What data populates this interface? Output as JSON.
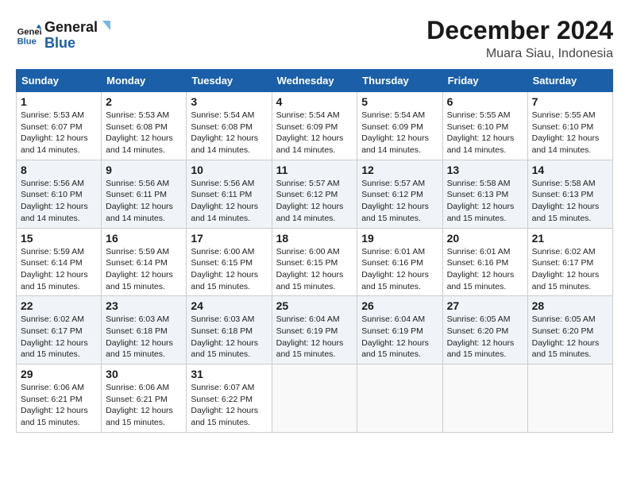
{
  "header": {
    "logo_line1": "General",
    "logo_line2": "Blue",
    "title": "December 2024",
    "subtitle": "Muara Siau, Indonesia"
  },
  "calendar": {
    "days_of_week": [
      "Sunday",
      "Monday",
      "Tuesday",
      "Wednesday",
      "Thursday",
      "Friday",
      "Saturday"
    ],
    "weeks": [
      [
        {
          "day": "1",
          "sunrise": "5:53 AM",
          "sunset": "6:07 PM",
          "daylight": "12 hours and 14 minutes."
        },
        {
          "day": "2",
          "sunrise": "5:53 AM",
          "sunset": "6:08 PM",
          "daylight": "12 hours and 14 minutes."
        },
        {
          "day": "3",
          "sunrise": "5:54 AM",
          "sunset": "6:08 PM",
          "daylight": "12 hours and 14 minutes."
        },
        {
          "day": "4",
          "sunrise": "5:54 AM",
          "sunset": "6:09 PM",
          "daylight": "12 hours and 14 minutes."
        },
        {
          "day": "5",
          "sunrise": "5:54 AM",
          "sunset": "6:09 PM",
          "daylight": "12 hours and 14 minutes."
        },
        {
          "day": "6",
          "sunrise": "5:55 AM",
          "sunset": "6:10 PM",
          "daylight": "12 hours and 14 minutes."
        },
        {
          "day": "7",
          "sunrise": "5:55 AM",
          "sunset": "6:10 PM",
          "daylight": "12 hours and 14 minutes."
        }
      ],
      [
        {
          "day": "8",
          "sunrise": "5:56 AM",
          "sunset": "6:10 PM",
          "daylight": "12 hours and 14 minutes."
        },
        {
          "day": "9",
          "sunrise": "5:56 AM",
          "sunset": "6:11 PM",
          "daylight": "12 hours and 14 minutes."
        },
        {
          "day": "10",
          "sunrise": "5:56 AM",
          "sunset": "6:11 PM",
          "daylight": "12 hours and 14 minutes."
        },
        {
          "day": "11",
          "sunrise": "5:57 AM",
          "sunset": "6:12 PM",
          "daylight": "12 hours and 14 minutes."
        },
        {
          "day": "12",
          "sunrise": "5:57 AM",
          "sunset": "6:12 PM",
          "daylight": "12 hours and 15 minutes."
        },
        {
          "day": "13",
          "sunrise": "5:58 AM",
          "sunset": "6:13 PM",
          "daylight": "12 hours and 15 minutes."
        },
        {
          "day": "14",
          "sunrise": "5:58 AM",
          "sunset": "6:13 PM",
          "daylight": "12 hours and 15 minutes."
        }
      ],
      [
        {
          "day": "15",
          "sunrise": "5:59 AM",
          "sunset": "6:14 PM",
          "daylight": "12 hours and 15 minutes."
        },
        {
          "day": "16",
          "sunrise": "5:59 AM",
          "sunset": "6:14 PM",
          "daylight": "12 hours and 15 minutes."
        },
        {
          "day": "17",
          "sunrise": "6:00 AM",
          "sunset": "6:15 PM",
          "daylight": "12 hours and 15 minutes."
        },
        {
          "day": "18",
          "sunrise": "6:00 AM",
          "sunset": "6:15 PM",
          "daylight": "12 hours and 15 minutes."
        },
        {
          "day": "19",
          "sunrise": "6:01 AM",
          "sunset": "6:16 PM",
          "daylight": "12 hours and 15 minutes."
        },
        {
          "day": "20",
          "sunrise": "6:01 AM",
          "sunset": "6:16 PM",
          "daylight": "12 hours and 15 minutes."
        },
        {
          "day": "21",
          "sunrise": "6:02 AM",
          "sunset": "6:17 PM",
          "daylight": "12 hours and 15 minutes."
        }
      ],
      [
        {
          "day": "22",
          "sunrise": "6:02 AM",
          "sunset": "6:17 PM",
          "daylight": "12 hours and 15 minutes."
        },
        {
          "day": "23",
          "sunrise": "6:03 AM",
          "sunset": "6:18 PM",
          "daylight": "12 hours and 15 minutes."
        },
        {
          "day": "24",
          "sunrise": "6:03 AM",
          "sunset": "6:18 PM",
          "daylight": "12 hours and 15 minutes."
        },
        {
          "day": "25",
          "sunrise": "6:04 AM",
          "sunset": "6:19 PM",
          "daylight": "12 hours and 15 minutes."
        },
        {
          "day": "26",
          "sunrise": "6:04 AM",
          "sunset": "6:19 PM",
          "daylight": "12 hours and 15 minutes."
        },
        {
          "day": "27",
          "sunrise": "6:05 AM",
          "sunset": "6:20 PM",
          "daylight": "12 hours and 15 minutes."
        },
        {
          "day": "28",
          "sunrise": "6:05 AM",
          "sunset": "6:20 PM",
          "daylight": "12 hours and 15 minutes."
        }
      ],
      [
        {
          "day": "29",
          "sunrise": "6:06 AM",
          "sunset": "6:21 PM",
          "daylight": "12 hours and 15 minutes."
        },
        {
          "day": "30",
          "sunrise": "6:06 AM",
          "sunset": "6:21 PM",
          "daylight": "12 hours and 15 minutes."
        },
        {
          "day": "31",
          "sunrise": "6:07 AM",
          "sunset": "6:22 PM",
          "daylight": "12 hours and 15 minutes."
        },
        null,
        null,
        null,
        null
      ]
    ]
  }
}
